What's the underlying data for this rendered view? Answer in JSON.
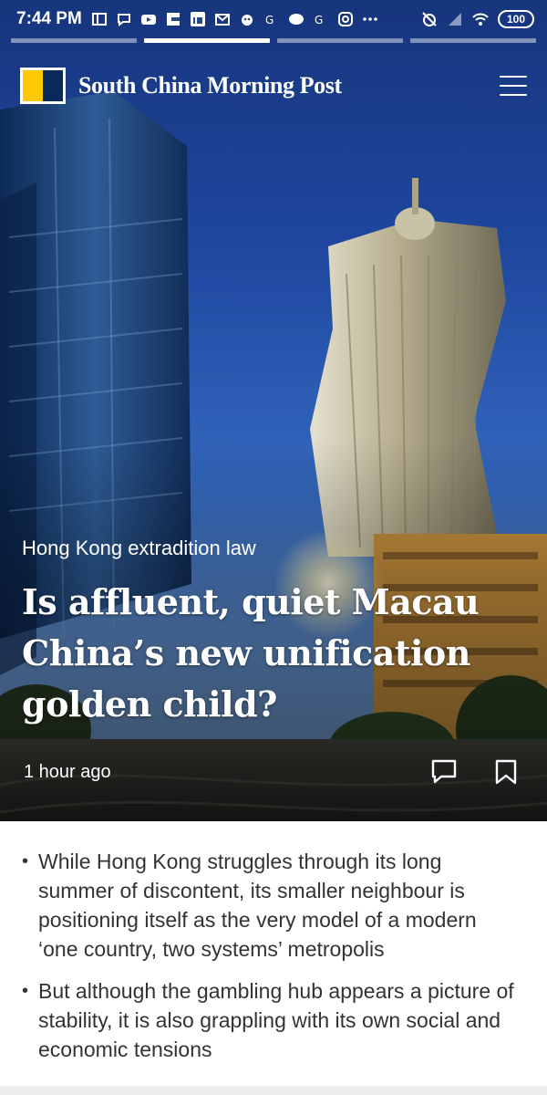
{
  "status_bar": {
    "time": "7:44 PM",
    "battery": "100",
    "left_icons": [
      "subscript-icon",
      "chat-icon",
      "youtube-icon",
      "flipboard-icon",
      "linkedin-icon",
      "mail-icon",
      "bird-icon",
      "app-icon",
      "news-icon",
      "app-icon",
      "instagram-icon",
      "more-dots-icon"
    ],
    "right_icons": [
      "alarm-off-icon",
      "signal-icon",
      "wifi-icon"
    ]
  },
  "story_progress": {
    "segments": 4,
    "active_index": 1
  },
  "app_header": {
    "logo_text": "South China Morning Post",
    "logo_colors": {
      "yellow": "#ffca05",
      "navy": "#0b2a5b"
    }
  },
  "article": {
    "topic": "Hong Kong extradition law",
    "headline": "Is affluent, quiet Macau China’s new unification golden child?",
    "timestamp": "1 hour ago",
    "summary_bullets": [
      "While Hong Kong struggles through its long summer of discontent, its smaller neighbour is positioning itself as the very model of a modern ‘one country, two systems’ metropolis",
      "But although the gambling hub appears a picture of stability, it is also grappling with its own social and economic tensions"
    ]
  }
}
